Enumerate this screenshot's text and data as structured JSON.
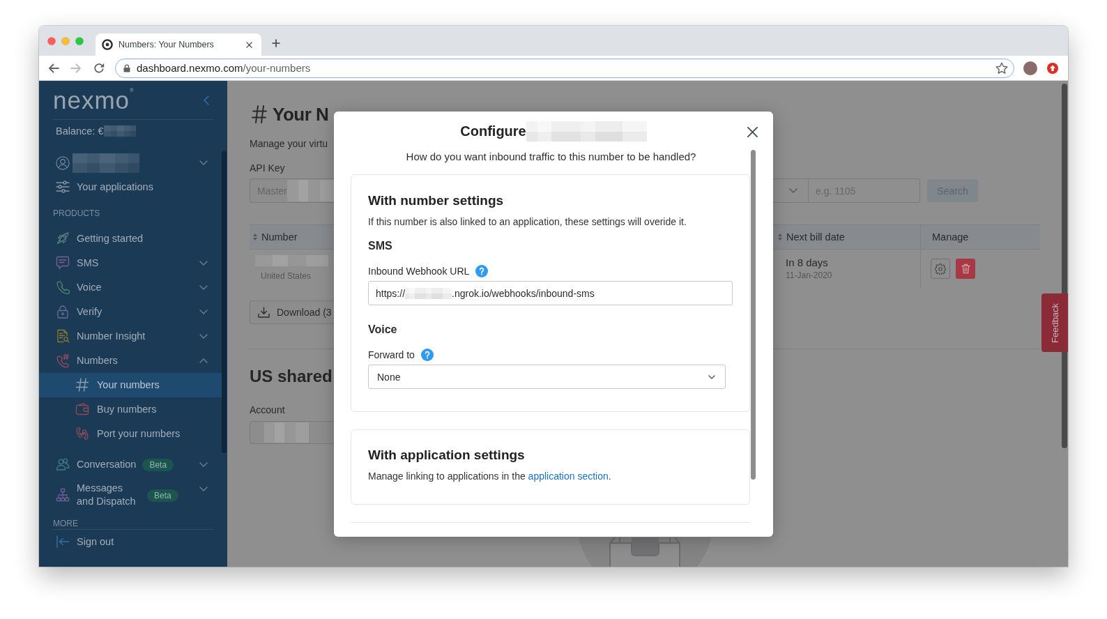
{
  "browser": {
    "tab": {
      "title": "Numbers: Your Numbers"
    },
    "back": {
      "disabled": false
    },
    "forward": {
      "disabled": true
    },
    "address": {
      "host": "dashboard.nexmo.com",
      "path": "/your-numbers",
      "focused": true
    }
  },
  "sidebar": {
    "logo": "nexmo$^{®}$",
    "balance_label": "Balance: €",
    "account_menu": {
      "expanded": false
    },
    "links": [
      {
        "label": "Your applications",
        "selected": false
      }
    ],
    "sections": [
      {
        "title": "PRODUCTS",
        "items": [
          {
            "label": "Getting started",
            "selected": false
          },
          {
            "label": "SMS",
            "selected": false,
            "expanded": false
          },
          {
            "label": "Voice",
            "selected": false,
            "expanded": false
          },
          {
            "label": "Verify",
            "selected": false,
            "expanded": false
          },
          {
            "label": "Number Insight",
            "selected": false,
            "expanded": false
          },
          {
            "label": "Numbers",
            "selected": false,
            "expanded": true,
            "children": [
              {
                "label": "Your numbers",
                "selected": true
              },
              {
                "label": "Buy numbers",
                "selected": false
              },
              {
                "label": "Port your numbers",
                "selected": false
              }
            ]
          },
          {
            "label": "Conversation",
            "selected": false,
            "expanded": false,
            "badge": "Beta"
          },
          {
            "label": "Messages and Dispatch",
            "selected": false,
            "expanded": false,
            "badge": "Beta"
          }
        ]
      },
      {
        "title": "MORE"
      }
    ],
    "footer": {
      "label": "Sign out"
    }
  },
  "page": {
    "title": "Your N",
    "subtitle": "Manage your virtu",
    "api_key": {
      "label": "API Key",
      "value": "Master"
    },
    "search": {
      "placeholder": "e.g. 1105",
      "button": {
        "label": "Search",
        "disabled": true
      }
    },
    "table": {
      "columns": [
        {
          "label": "Number",
          "sortable": true
        },
        {
          "label": "Next bill date",
          "sortable": true
        },
        {
          "label": "Manage",
          "sortable": false
        }
      ],
      "rows": [
        {
          "country": "United States",
          "next_bill": "In 8 days",
          "bill_date": "11-Jan-2020"
        }
      ]
    },
    "download_button": "Download (3",
    "shared_section": {
      "title": "US shared",
      "account_label": "Account"
    },
    "feedback": "Feedback"
  },
  "modal": {
    "title": "Configure",
    "subtitle": "How do you want inbound traffic to this number to be handled?",
    "sections": [
      {
        "title": "With number settings",
        "description": "If this number is also linked to an application, these settings will overide it.",
        "groups": [
          {
            "title": "SMS",
            "field": {
              "kind": "text",
              "label": "Inbound Webhook URL",
              "value_start": "https://",
              "value_end": ".ngrok.io/webhooks/inbound-sms"
            }
          },
          {
            "title": "Voice",
            "field": {
              "kind": "select",
              "label": "Forward to",
              "value": "None"
            }
          }
        ]
      },
      {
        "title": "With application settings",
        "description": "Manage linking to applications in the ",
        "link": "application section",
        "description_end": "."
      }
    ]
  }
}
